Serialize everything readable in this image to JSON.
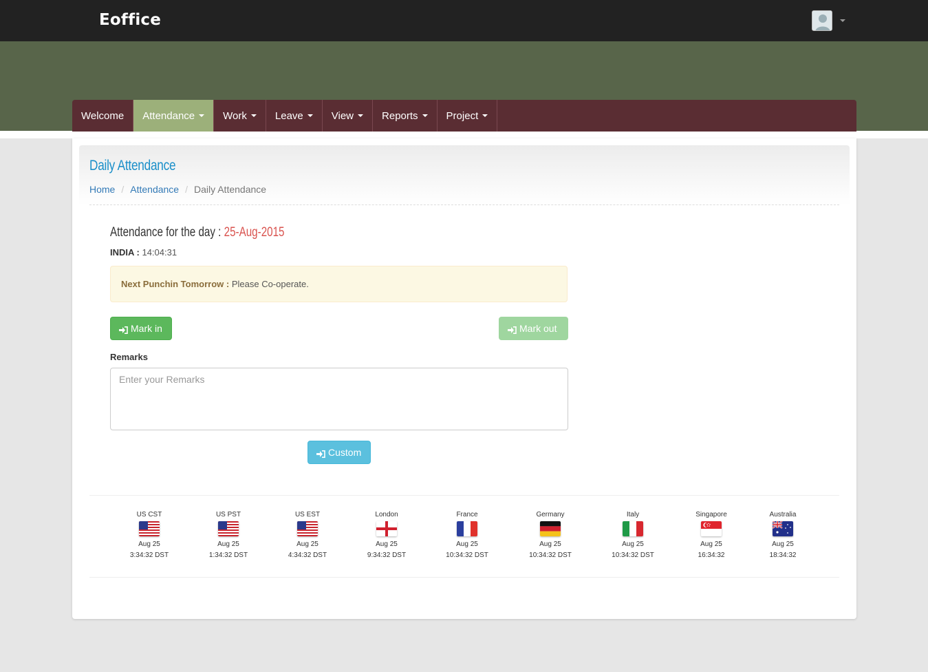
{
  "brand": "Eoffice",
  "nav": {
    "items": [
      {
        "label": "Welcome",
        "dropdown": false,
        "active": false
      },
      {
        "label": "Attendance",
        "dropdown": true,
        "active": true
      },
      {
        "label": "Work",
        "dropdown": true,
        "active": false
      },
      {
        "label": "Leave",
        "dropdown": true,
        "active": false
      },
      {
        "label": "View",
        "dropdown": true,
        "active": false
      },
      {
        "label": "Reports",
        "dropdown": true,
        "active": false
      },
      {
        "label": "Project",
        "dropdown": true,
        "active": false
      }
    ]
  },
  "page": {
    "title": "Daily Attendance",
    "breadcrumb": [
      "Home",
      "Attendance",
      "Daily Attendance"
    ]
  },
  "attendance": {
    "day_label": "Attendance for the day : ",
    "day_date": "25-Aug-2015",
    "india_label": "INDIA : ",
    "india_time": "14:04:31",
    "alert_bold": "Next Punchin Tomorrow : ",
    "alert_text": "Please Co-operate.",
    "mark_in_label": "Mark in",
    "mark_out_label": "Mark out",
    "remarks_label": "Remarks",
    "remarks_placeholder": "Enter your Remarks",
    "custom_label": "Custom"
  },
  "timezones": [
    {
      "name": "US CST",
      "flag": "us-flag-icon",
      "date": "Aug 25",
      "time": "3:34:32 DST"
    },
    {
      "name": "US PST",
      "flag": "us-flag-icon",
      "date": "Aug 25",
      "time": "1:34:32 DST"
    },
    {
      "name": "US EST",
      "flag": "us-flag-icon",
      "date": "Aug 25",
      "time": "4:34:32 DST"
    },
    {
      "name": "London",
      "flag": "england-flag-icon",
      "date": "Aug 25",
      "time": "9:34:32 DST"
    },
    {
      "name": "France",
      "flag": "france-flag-icon",
      "date": "Aug 25",
      "time": "10:34:32 DST"
    },
    {
      "name": "Germany",
      "flag": "germany-flag-icon",
      "date": "Aug 25",
      "time": "10:34:32 DST"
    },
    {
      "name": "Italy",
      "flag": "italy-flag-icon",
      "date": "Aug 25",
      "time": "10:34:32 DST"
    },
    {
      "name": "Singapore",
      "flag": "singapore-flag-icon",
      "date": "Aug 25",
      "time": "16:34:32"
    },
    {
      "name": "Australia",
      "flag": "australia-flag-icon",
      "date": "Aug 25",
      "time": "18:34:32"
    }
  ],
  "colors": {
    "topbar": "#222222",
    "hero": "#58654a",
    "navbar": "#5a2d33",
    "nav_active": "#9cb07a",
    "title": "#1a8fc9",
    "date_red": "#d9534f",
    "success": "#5cb85c",
    "info": "#5bc0de"
  }
}
